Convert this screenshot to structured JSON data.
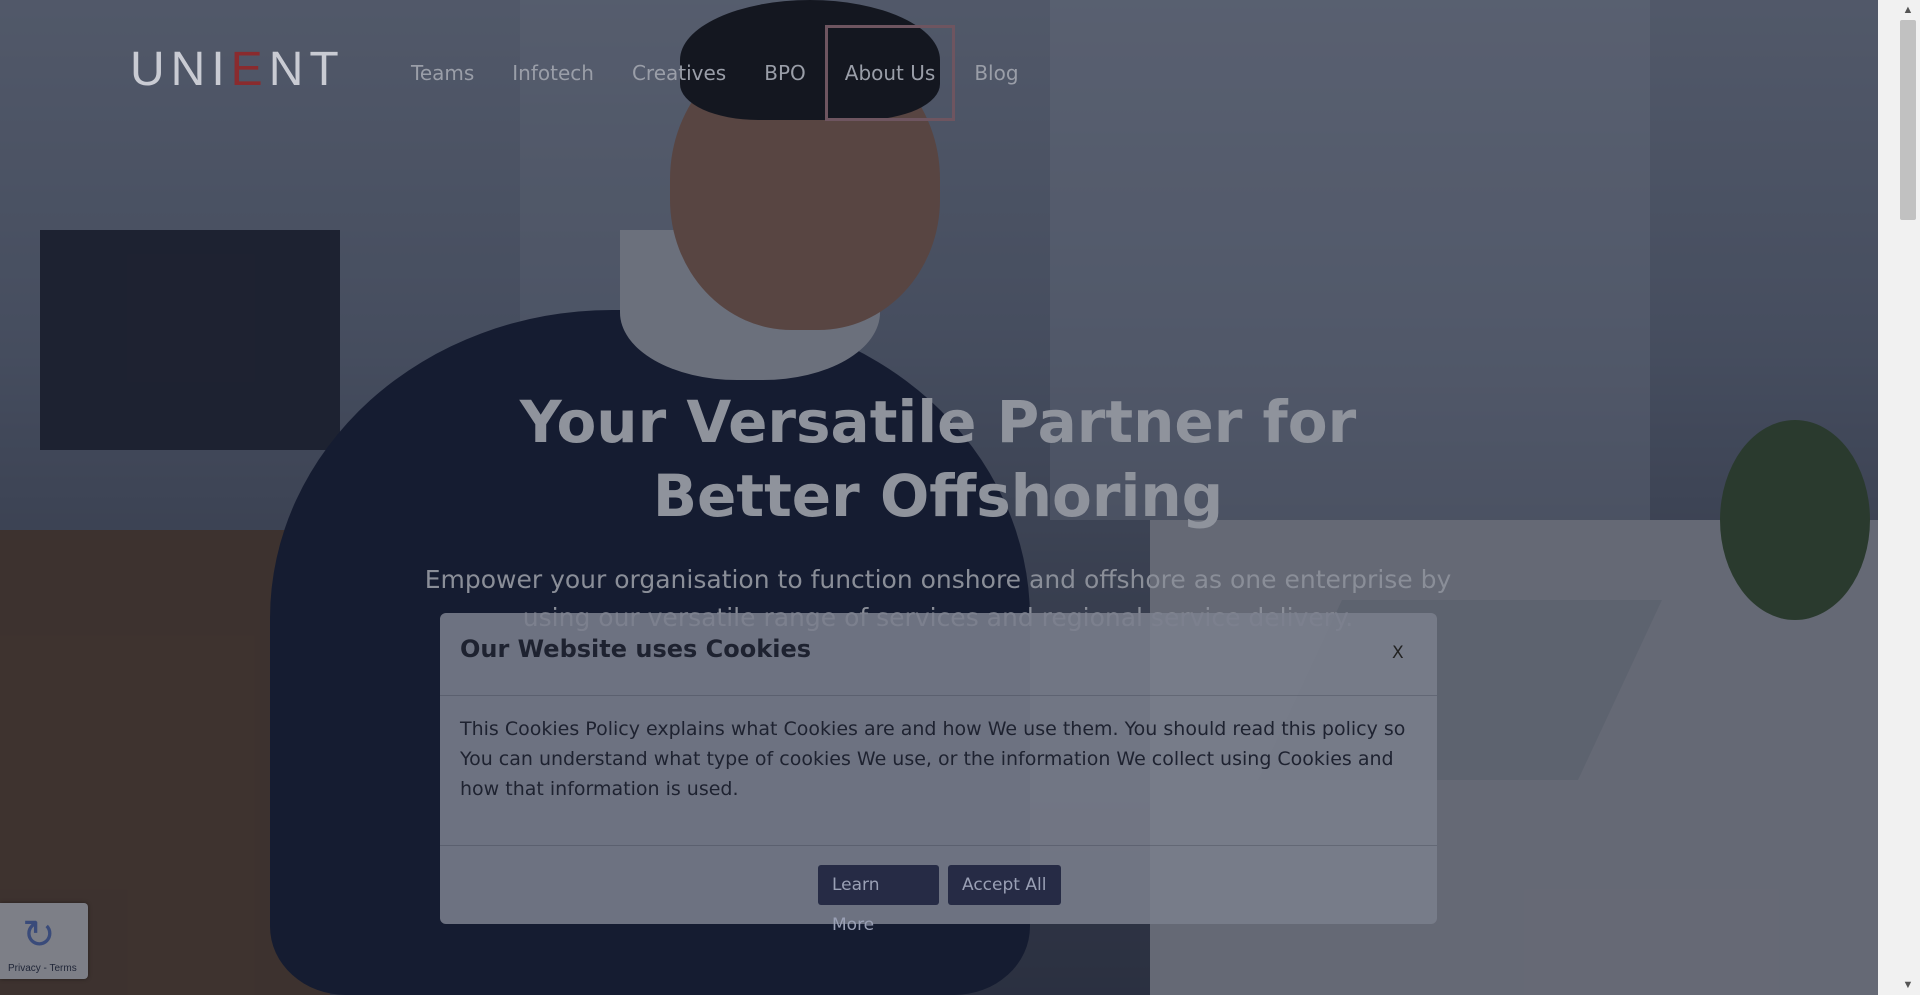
{
  "brand": {
    "logo_text_before": "UNI",
    "logo_text_mark": "E",
    "logo_text_after": "NT"
  },
  "nav": {
    "items": [
      {
        "label": "Teams",
        "active": false
      },
      {
        "label": "Infotech",
        "active": false
      },
      {
        "label": "Creatives",
        "active": false
      },
      {
        "label": "BPO",
        "active": false
      },
      {
        "label": "About Us",
        "active": true
      },
      {
        "label": "Blog",
        "active": false
      }
    ]
  },
  "hero": {
    "title": "Your Versatile Partner for Better Offshoring",
    "subtitle": "Empower your organisation to function onshore and offshore as one enterprise by using our versatile range of services and regional service delivery."
  },
  "cookie_modal": {
    "title": "Our Website uses Cookies",
    "close_label": "X",
    "body": "This Cookies Policy explains what Cookies are and how We use them. You should read this policy so You can understand what type of cookies We use, or the information We collect using Cookies and how that information is used.",
    "learn_more_label": "Learn More",
    "accept_label": "Accept All"
  },
  "recaptcha": {
    "links": "Privacy - Terms"
  },
  "colors": {
    "brand_accent": "#8a2b2e",
    "button_bg": "#262b45",
    "overlay": "#12162694"
  },
  "icons": {
    "scroll_up": "triangle-up-icon",
    "scroll_down": "triangle-down-icon",
    "recaptcha": "recaptcha-icon"
  }
}
